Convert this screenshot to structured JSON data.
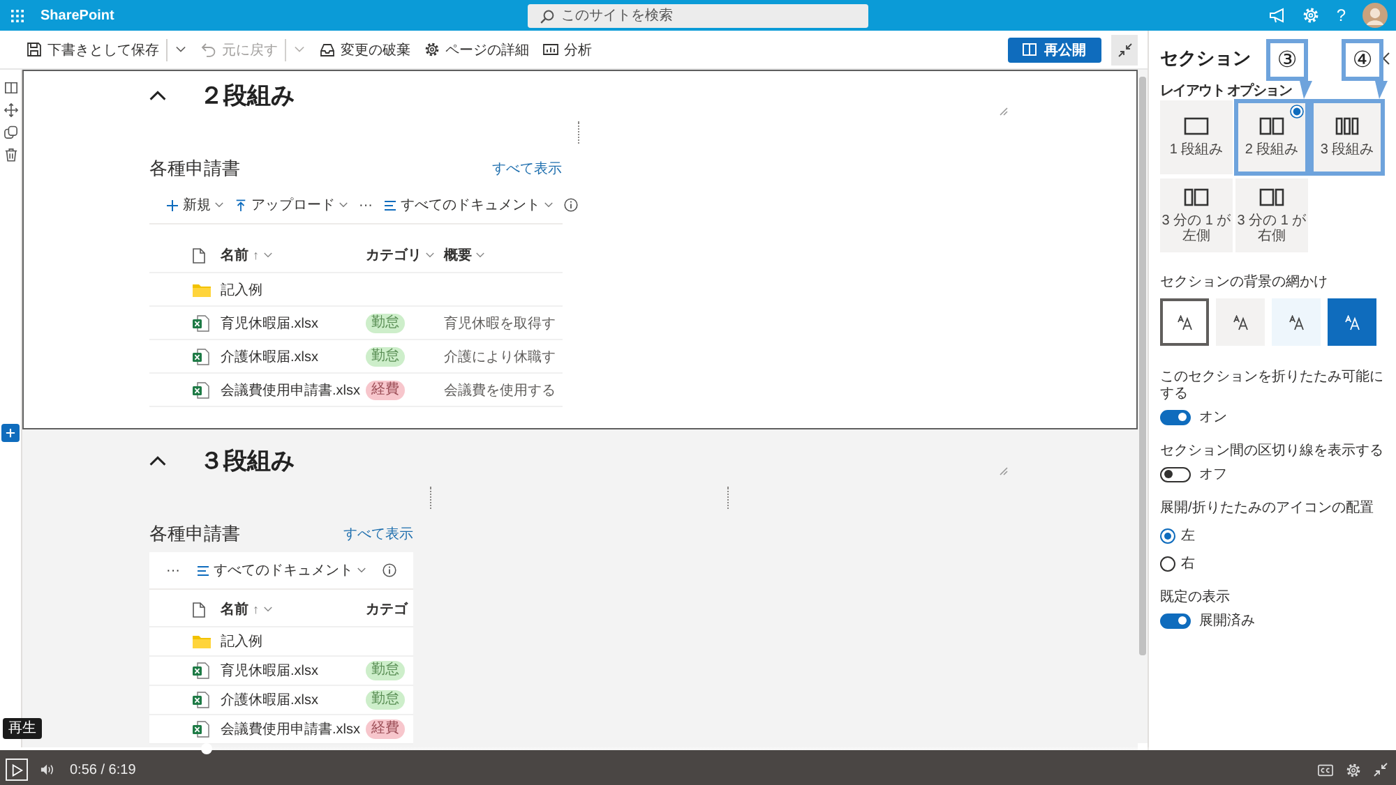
{
  "top_bar": {
    "app_name": "SharePoint",
    "search": {
      "placeholder": "このサイトを検索"
    },
    "help": "?"
  },
  "toolbar": {
    "items": [
      {
        "kind": "save",
        "label": "下書きとして保存",
        "disabled": false,
        "menu": true
      },
      {
        "kind": "undo",
        "label": "元に戻す",
        "disabled": true,
        "menu": true
      },
      {
        "kind": "discard",
        "label": "変更の破棄",
        "disabled": false,
        "menu": false
      },
      {
        "kind": "details",
        "label": "ページの詳細",
        "disabled": false,
        "menu": false
      },
      {
        "kind": "analytics",
        "label": "分析",
        "disabled": false,
        "menu": false
      }
    ],
    "publish": {
      "label": "再公開"
    }
  },
  "sections": [
    {
      "heading": "２段組み",
      "expanded": true,
      "selected": true,
      "kind": "two-column",
      "web_part": {
        "title": "各種申請書",
        "link": "すべて表示",
        "commands": [
          {
            "kind": "new",
            "label": "新規"
          },
          {
            "kind": "upload",
            "label": "アップロード"
          },
          {
            "kind": "more",
            "label": "···"
          },
          {
            "kind": "view",
            "label": "すべてのドキュメント"
          },
          {
            "kind": "info"
          }
        ],
        "columns": [
          {
            "kind": "type"
          },
          {
            "kind": "name",
            "label": "名前",
            "sort": "↑",
            "menu": true
          },
          {
            "kind": "category",
            "label": "カテゴリ",
            "menu": true
          },
          {
            "kind": "summary",
            "label": "概要",
            "menu": true
          }
        ],
        "rows": [
          {
            "kind": "folder",
            "name": "記入例"
          },
          {
            "kind": "excel",
            "name": "育児休暇届.xlsx",
            "category": {
              "label": "勤怠",
              "color": "#cdeeca"
            },
            "summary": "育児休暇を取得す"
          },
          {
            "kind": "excel",
            "name": "介護休暇届.xlsx",
            "category": {
              "label": "勤怠",
              "color": "#cdeeca"
            },
            "summary": "介護により休職す"
          },
          {
            "kind": "excel",
            "name": "会議費使用申請書.xlsx",
            "category": {
              "label": "経費",
              "color": "#f7c6cc"
            },
            "summary": "会議費を使用する"
          }
        ]
      }
    },
    {
      "heading": "３段組み",
      "expanded": true,
      "selected": false,
      "kind": "three-column",
      "web_part": {
        "title": "各種申請書",
        "link": "すべて表示",
        "commands": [
          {
            "kind": "more",
            "label": "···"
          },
          {
            "kind": "view",
            "label": "すべてのドキュメント"
          },
          {
            "kind": "info"
          }
        ],
        "columns": [
          {
            "kind": "type"
          },
          {
            "kind": "name",
            "label": "名前",
            "sort": "↑",
            "menu": true
          },
          {
            "kind": "category",
            "label": "カテゴ",
            "menu": false
          }
        ],
        "rows": [
          {
            "kind": "folder",
            "name": "記入例"
          },
          {
            "kind": "excel",
            "name": "育児休暇届.xlsx",
            "category": {
              "label": "勤怠",
              "color": "#cdeeca"
            }
          },
          {
            "kind": "excel",
            "name": "介護休暇届.xlsx",
            "category": {
              "label": "勤怠",
              "color": "#cdeeca"
            }
          },
          {
            "kind": "excel",
            "name": "会議費使用申請書.xlsx",
            "category": {
              "label": "経費",
              "color": "#f7c6cc"
            }
          }
        ]
      }
    }
  ],
  "panel": {
    "title": "セクション",
    "layout_label": "レイアウト オプション",
    "layout_options": [
      {
        "kind": "one",
        "label": "1 段組み",
        "selected": false
      },
      {
        "kind": "two",
        "label": "2 段組み",
        "selected": true,
        "callout": "③"
      },
      {
        "kind": "three",
        "label": "3 段組み",
        "selected": false,
        "callout": "④"
      },
      {
        "kind": "third-left",
        "label": "3 分の 1 が左側",
        "selected": false
      },
      {
        "kind": "third-right",
        "label": "3 分の 1 が右側",
        "selected": false
      }
    ],
    "background_label": "セクションの背景の網かけ",
    "backgrounds": [
      {
        "selected": true,
        "color": "#ffffff"
      },
      {
        "selected": false,
        "color": "#f3f2f1"
      },
      {
        "selected": false,
        "color": "#eef6fc"
      },
      {
        "selected": false,
        "color": "#0f6cbd"
      }
    ],
    "settings": [
      {
        "kind": "toggle",
        "label": "このセクションを折りたたみ可能にする",
        "on": true,
        "state": "オン"
      },
      {
        "kind": "toggle",
        "label": "セクション間の区切り線を表示する",
        "on": false,
        "state": "オフ"
      },
      {
        "kind": "radio",
        "label": "展開/折りたたみのアイコンの配置",
        "options": [
          {
            "label": "左",
            "selected": true
          },
          {
            "label": "右",
            "selected": false
          }
        ]
      },
      {
        "kind": "toggle",
        "label": "既定の表示",
        "on": true,
        "state": "展開済み"
      }
    ]
  },
  "video": {
    "tooltip": "再生",
    "time": "0:56 / 6:19",
    "progress": {
      "level": 0.148
    }
  }
}
